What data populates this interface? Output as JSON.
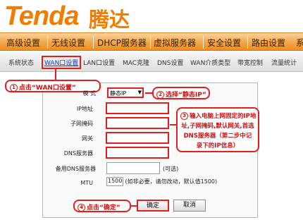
{
  "brand": {
    "logo_en": "Tenda",
    "logo_cn": "腾达",
    "color": "#f07d00"
  },
  "main_nav": [
    {
      "label": "高级设置"
    },
    {
      "label": "无线设置"
    },
    {
      "label": "DHCP服务器"
    },
    {
      "label": "虚拟服务器"
    },
    {
      "label": "安全设置"
    },
    {
      "label": "路由设置"
    },
    {
      "label": "系"
    }
  ],
  "sub_nav": [
    {
      "label": "系统状态"
    },
    {
      "label": "WAN口设置"
    },
    {
      "label": "LAN口设置"
    },
    {
      "label": "MAC克隆"
    },
    {
      "label": "DNS设置"
    },
    {
      "label": "WAN介质类型"
    },
    {
      "label": "带宽控制"
    },
    {
      "label": "流量统计"
    }
  ],
  "form": {
    "mode_label": "模  式",
    "mode_value": "静态IP",
    "ip_label": "IP地址",
    "mask_label": "子网掩码",
    "gateway_label": "网关",
    "dns_label": "DNS服务器",
    "dns2_label": "备用DNS服务器",
    "dns2_note": "(可选)",
    "mtu_label": "MTU",
    "mtu_value": "1500",
    "mtu_note": "(如非必要，请勿改动，默认值1500)",
    "ok_label": "确定",
    "cancel_label": "取消"
  },
  "callouts": {
    "step1": {
      "num": "1",
      "text": "点击“WAN口设置”"
    },
    "step2": {
      "num": "2",
      "text": "选择“静态IP”"
    },
    "step3": {
      "num": "3",
      "lines": [
        "输入电脑上网固定的IP地",
        "址,子网掩码,默认网关,首选",
        "DNS服务器（第二步中记",
        "录下的IP信息）"
      ]
    },
    "step4": {
      "num": "4",
      "text": "点击“确定”"
    }
  },
  "colors": {
    "accent_red": "#e02020",
    "nav_orange": "#f3a64a"
  }
}
